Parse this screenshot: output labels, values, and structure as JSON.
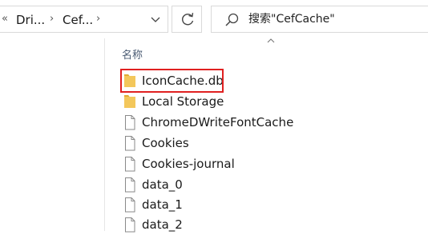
{
  "breadcrumb": {
    "items": [
      {
        "label": "Dri..."
      },
      {
        "label": "Cef..."
      }
    ]
  },
  "search": {
    "placeholder": "搜索\"CefCache\""
  },
  "file_list": {
    "column_header": "名称",
    "items": [
      {
        "name": "IconCache.db",
        "type": "folder",
        "highlighted": true
      },
      {
        "name": "Local Storage",
        "type": "folder"
      },
      {
        "name": "ChromeDWriteFontCache",
        "type": "file"
      },
      {
        "name": "Cookies",
        "type": "file"
      },
      {
        "name": "Cookies-journal",
        "type": "file"
      },
      {
        "name": "data_0",
        "type": "file"
      },
      {
        "name": "data_1",
        "type": "file"
      },
      {
        "name": "data_2",
        "type": "file"
      }
    ]
  },
  "colors": {
    "folder": "#f3c75b",
    "highlight_border": "#e02020",
    "header_text": "#4a5b73"
  }
}
